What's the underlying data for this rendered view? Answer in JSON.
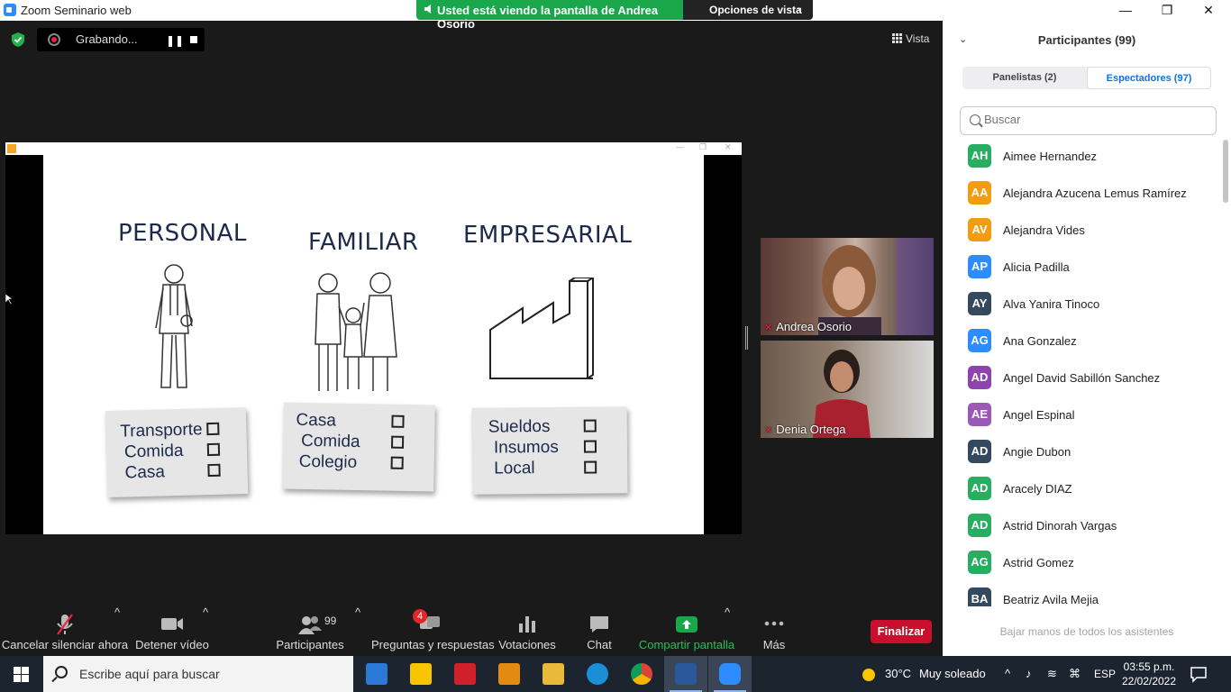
{
  "window": {
    "title": "Zoom Seminario web",
    "minimize": "—",
    "maximize": "❐",
    "close": "✕"
  },
  "banner": {
    "viewing": "Usted está viendo la pantalla de Andrea Osorio",
    "view_options": "Opciones de vista"
  },
  "recording": {
    "label": "Grabando..."
  },
  "view_label": "Vista",
  "slide": {
    "headings": [
      "PERSONAL",
      "FAMILIAR",
      "EMPRESARIAL"
    ],
    "cards": [
      [
        "Transporte",
        "Comida",
        "Casa"
      ],
      [
        "Casa",
        "Comida",
        "Colegio"
      ],
      [
        "Sueldos",
        "Insumos",
        "Local"
      ]
    ]
  },
  "videos": [
    {
      "name": "Andrea Osorio"
    },
    {
      "name": "Denia Ortega"
    }
  ],
  "toolbar": {
    "mute": "Cancelar silenciar ahora",
    "video": "Detener vídeo",
    "participants": "Participantes",
    "participants_count": "99",
    "qa": "Preguntas y respuestas",
    "qa_badge": "4",
    "polls": "Votaciones",
    "chat": "Chat",
    "share": "Compartir pantalla",
    "more": "Más",
    "end": "Finalizar"
  },
  "panel": {
    "title": "Participantes (99)",
    "tab_panelists": "Panelistas (2)",
    "tab_attendees": "Espectadores (97)",
    "search_placeholder": "Buscar",
    "lower_hands": "Bajar manos de todos los asistentes",
    "participants": [
      {
        "initials": "AH",
        "name": "Aimee Hernandez",
        "color": "#27ae60"
      },
      {
        "initials": "AA",
        "name": "Alejandra Azucena Lemus Ramírez",
        "color": "#f39c12"
      },
      {
        "initials": "AV",
        "name": "Alejandra Vides",
        "color": "#f39c12"
      },
      {
        "initials": "AP",
        "name": "Alicia Padilla",
        "color": "#2d8cff"
      },
      {
        "initials": "AY",
        "name": "Alva Yanira Tinoco",
        "color": "#34495e"
      },
      {
        "initials": "AG",
        "name": "Ana Gonzalez",
        "color": "#2d8cff"
      },
      {
        "initials": "AD",
        "name": "Angel David Sabillón Sanchez",
        "color": "#8e44ad"
      },
      {
        "initials": "AE",
        "name": "Angel Espinal",
        "color": "#9b59b6"
      },
      {
        "initials": "AD",
        "name": "Angie Dubon",
        "color": "#34495e"
      },
      {
        "initials": "AD",
        "name": "Aracely DIAZ",
        "color": "#27ae60"
      },
      {
        "initials": "AD",
        "name": "Astrid Dinorah Vargas",
        "color": "#27ae60"
      },
      {
        "initials": "AG",
        "name": "Astrid Gomez",
        "color": "#27ae60"
      },
      {
        "initials": "BA",
        "name": "Beatriz Avila Mejia",
        "color": "#34495e"
      }
    ]
  },
  "taskbar": {
    "search": "Escribe aquí para buscar",
    "temperature": "30°C",
    "weather": "Muy soleado",
    "language": "ESP",
    "time": "03:55 p.m.",
    "date": "22/02/2022"
  },
  "colors": {
    "zoom_blue": "#2d8cff",
    "banner_green": "#1aa64a",
    "end_red": "#c8102e",
    "share_green": "#1aa64a"
  }
}
